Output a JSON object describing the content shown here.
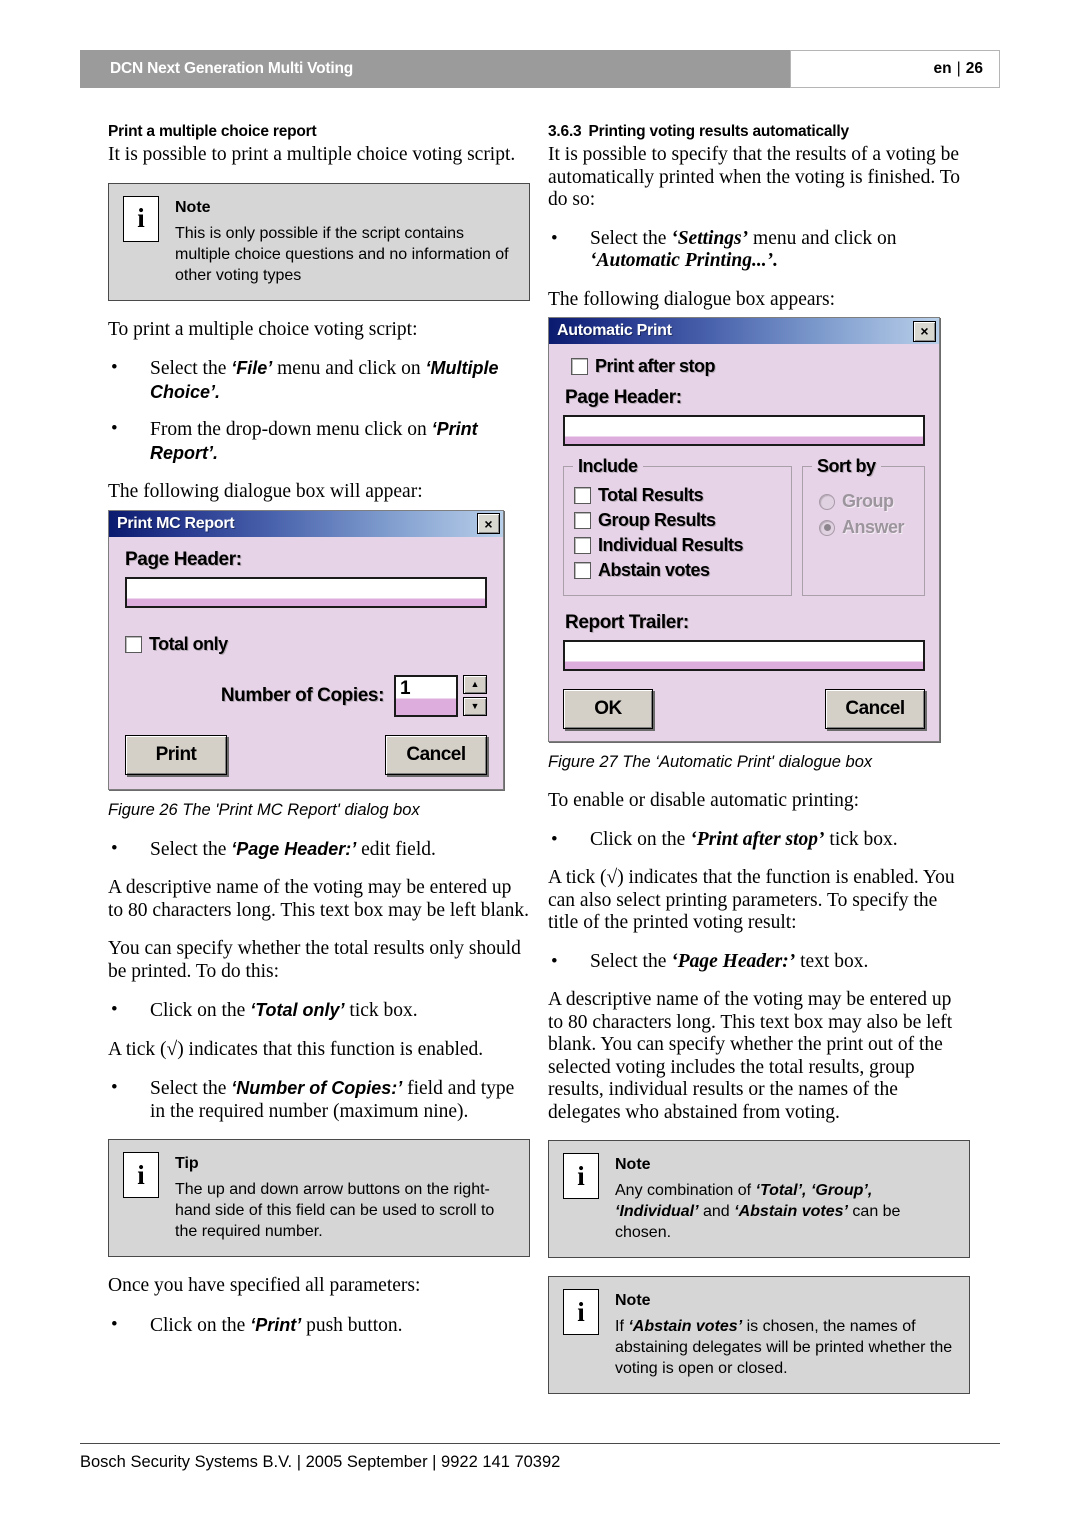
{
  "header": {
    "title": "DCN Next Generation Multi Voting",
    "language": "en",
    "separator": "|",
    "page_number": "26"
  },
  "left_column": {
    "heading": "Print a multiple choice report",
    "intro": "It is possible to print a multiple choice voting script.",
    "note_1": {
      "icon": "i",
      "title": "Note",
      "text": "This is only possible if the script contains multiple choice questions and no information of other voting types"
    },
    "lead_in": "To print a multiple choice voting script:",
    "bullet_1_pre": "Select the ",
    "bullet_1_b1": "‘File’",
    "bullet_1_mid": " menu and click on ",
    "bullet_1_b2": "‘Multiple Choice’.",
    "bullet_2_pre": "From the drop-down menu click on ",
    "bullet_2_b1": "‘Print Report’.",
    "dialog_lead": "The following dialogue box will appear:",
    "figure_caption": "Figure 26 The 'Print MC Report' dialog box",
    "bullet_3_pre": "Select the ",
    "bullet_3_b1": "‘Page Header:’",
    "bullet_3_post": " edit field.",
    "para_descriptive": "A descriptive name of the voting may be entered up to 80 characters long. This text box may be left blank.",
    "para_total": "You can specify whether the total results only should be printed. To do this:",
    "bullet_4_pre": "Click on the ",
    "bullet_4_b1": "‘Total only’",
    "bullet_4_post": " tick box.",
    "para_tick": "A tick (√) indicates that this function is enabled.",
    "bullet_5_pre": "Select the ",
    "bullet_5_b1": "‘Number of Copies:’",
    "bullet_5_post": " field and type in the required number (maximum nine).",
    "tip": {
      "icon": "i",
      "title": "Tip",
      "text": "The up and down arrow buttons on the right-hand side of this field can be used to scroll to the required number."
    },
    "para_once": "Once you have specified all parameters:",
    "bullet_6_pre": "Click on the ",
    "bullet_6_b1": "‘Print’",
    "bullet_6_post": " push button."
  },
  "right_column": {
    "section_number": "3.6.3",
    "heading": "Printing voting results automatically",
    "intro": "It is possible to specify that the results of a voting be automatically printed when the voting is finished. To do so:",
    "bullet_1_pre": "Select the ",
    "bullet_1_b1": "‘Settings’",
    "bullet_1_mid": " menu and click on ",
    "bullet_1_b2": "‘Automatic Printing...’.",
    "dialog_lead": "The following dialogue box appears:",
    "figure_caption": "Figure 27 The ‘Automatic Print' dialogue box",
    "para_enable": "To enable or disable automatic printing:",
    "bullet_2_pre": "Click on the ",
    "bullet_2_b1": "‘Print after stop’",
    "bullet_2_post": " tick box.",
    "para_tick": "A tick (√) indicates that the function is enabled. You can also select printing parameters. To specify the title of the printed voting result:",
    "bullet_3_pre": "Select the ",
    "bullet_3_b1": "‘Page Header:’",
    "bullet_3_post": " text box.",
    "para_descriptive": "A descriptive name of the voting may be entered up to 80 characters long. This text box may also be left blank. You can specify whether the print out of the selected voting includes the total results, group results, individual results or the names of the delegates who abstained from voting.",
    "note_2": {
      "icon": "i",
      "title": "Note",
      "text_1": "Any combination of ",
      "text_b1": "‘Total’, ‘Group’, ‘Individual’",
      "text_2": " and ",
      "text_b2": "‘Abstain votes’",
      "text_3": " can be chosen."
    },
    "note_3": {
      "icon": "i",
      "title": "Note",
      "text_1": "If ",
      "text_b1": "‘Abstain votes’",
      "text_2": " is chosen, the names of abstaining delegates will be printed whether the voting is open or closed."
    }
  },
  "dialog_print_mc": {
    "title": "Print MC Report",
    "close_label": "×",
    "page_header_label": "Page Header:",
    "page_header_value": "",
    "total_only_label": "Total only",
    "total_only_checked": false,
    "number_of_copies_label": "Number of Copies:",
    "number_of_copies_value": "1",
    "spin_up": "▲",
    "spin_down": "▼",
    "print_button": "Print",
    "cancel_button": "Cancel"
  },
  "dialog_automatic_print": {
    "title": "Automatic Print",
    "close_label": "×",
    "print_after_stop_label": "Print after stop",
    "print_after_stop_checked": false,
    "page_header_label": "Page Header:",
    "page_header_value": "",
    "include_group_label": "Include",
    "include_options": [
      {
        "label": "Total Results",
        "checked": false
      },
      {
        "label": "Group Results",
        "checked": false
      },
      {
        "label": "Individual Results",
        "checked": false
      },
      {
        "label": "Abstain votes",
        "checked": false
      }
    ],
    "sort_by_group_label": "Sort by",
    "sort_options": [
      {
        "label": "Group",
        "selected": false
      },
      {
        "label": "Answer",
        "selected": true
      }
    ],
    "report_trailer_label": "Report Trailer:",
    "report_trailer_value": "",
    "ok_button": "OK",
    "cancel_button": "Cancel"
  },
  "footer": {
    "text": "Bosch Security Systems B.V. | 2005 September | 9922 141 70392"
  },
  "colors": {
    "header_band": "#9b9b9b",
    "note_bg": "#d6d6d6",
    "dialog_bg": "#e7d3e7",
    "titlebar_start": "#0a1a6e",
    "titlebar_end": "#b9d0ea",
    "field_accent": "#ddaedd",
    "button_face": "#d4d0c8"
  }
}
